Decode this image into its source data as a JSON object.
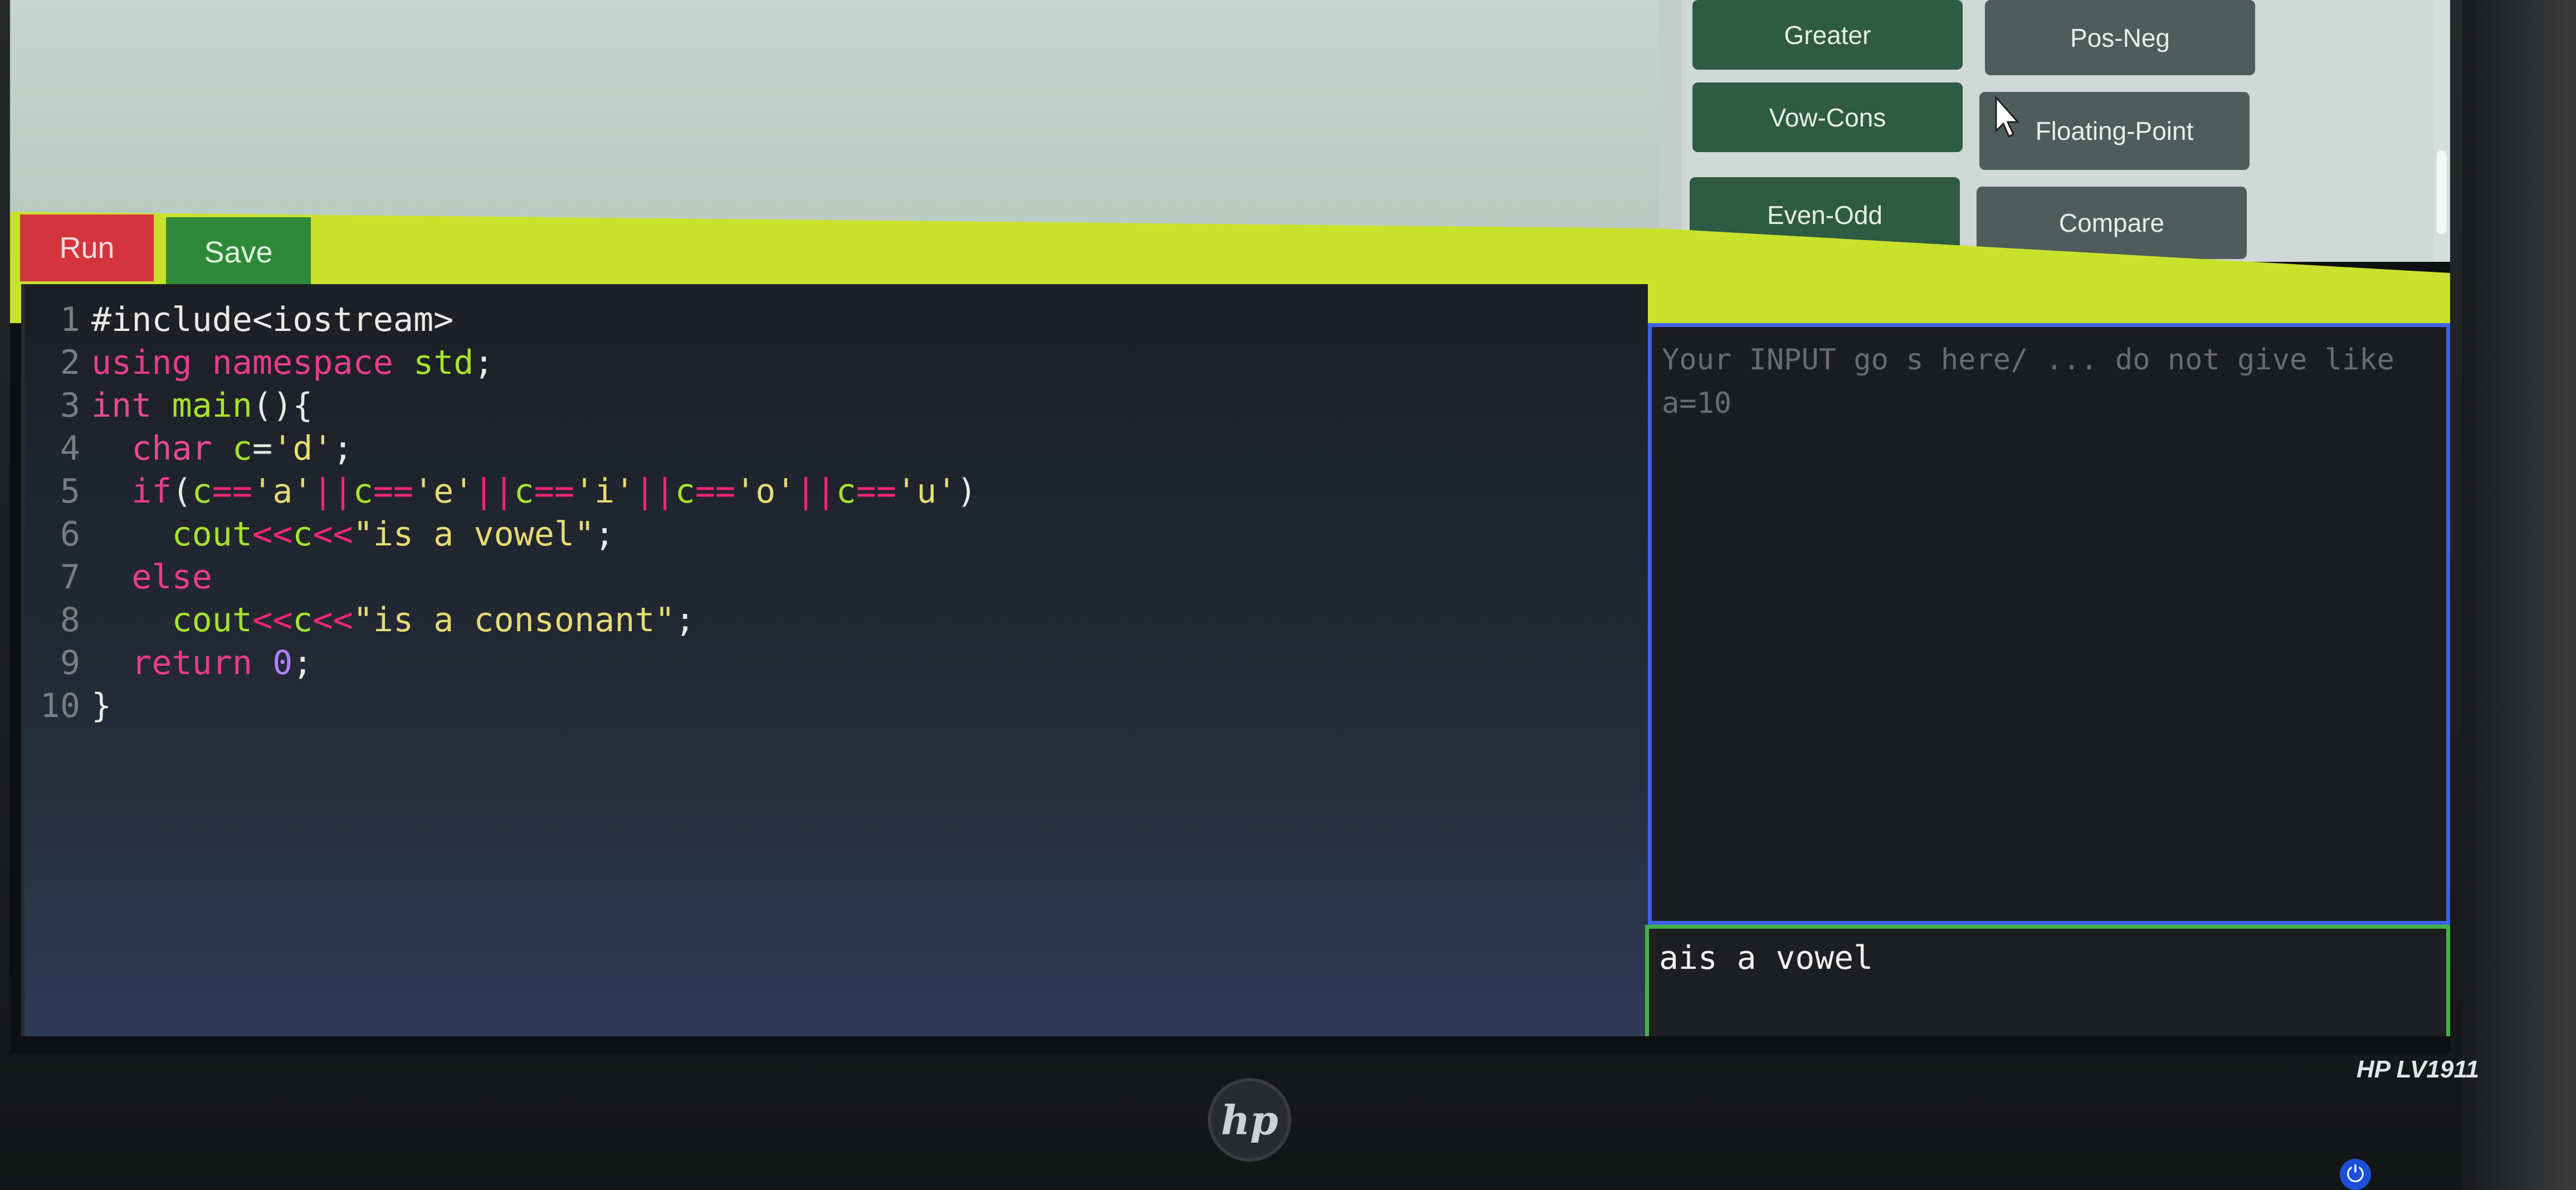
{
  "toolbar": {
    "run_label": "Run",
    "save_label": "Save"
  },
  "snippets": [
    {
      "label": "Greater"
    },
    {
      "label": "Pos-Neg"
    },
    {
      "label": "Vow-Cons"
    },
    {
      "label": "Floating-Point"
    },
    {
      "label": "Even-Odd"
    },
    {
      "label": "Compare"
    }
  ],
  "editor": {
    "lines": [
      {
        "num": "1",
        "code": "#include<iostream>"
      },
      {
        "num": "2",
        "code": "using namespace std;"
      },
      {
        "num": "3",
        "code": "int main(){"
      },
      {
        "num": "4",
        "code": "  char c='d';"
      },
      {
        "num": "5",
        "code": "  if(c=='a'||c=='e'||c=='i'||c=='o'||c=='u')"
      },
      {
        "num": "6",
        "code": "    cout<<c<<\"is a vowel\";"
      },
      {
        "num": "7",
        "code": "  else"
      },
      {
        "num": "8",
        "code": "    cout<<c<<\"is a consonant\";"
      },
      {
        "num": "9",
        "code": "  return 0;"
      },
      {
        "num": "10",
        "code": "}"
      }
    ]
  },
  "input": {
    "placeholder": "Your INPUT go s here/ ... do not give like a=10"
  },
  "output": {
    "text": "ais a vowel"
  },
  "monitor": {
    "brand": "hp",
    "model": "HP LV1911"
  },
  "colors": {
    "run": "#d4343e",
    "save": "#2e8a3a",
    "toolbar": "#c8e22c",
    "input_border": "#3e62e6",
    "output_border": "#42b442"
  }
}
